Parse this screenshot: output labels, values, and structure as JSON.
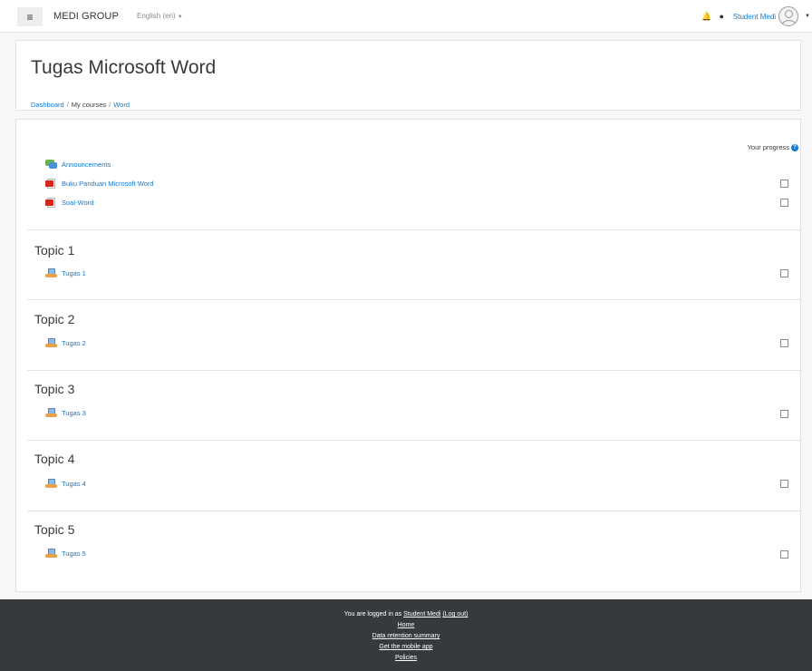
{
  "navbar": {
    "brand": "MEDI GROUP",
    "language": "English (en)",
    "user_name": "Student Medi"
  },
  "header": {
    "title": "Tugas Microsoft Word",
    "breadcrumb": [
      "Dashboard",
      "My courses",
      "Word"
    ]
  },
  "course": {
    "progress_label": "Your progress",
    "general_activities": [
      {
        "label": "Announcements",
        "icon": "forum-icon",
        "has_checkbox": false
      },
      {
        "label": "Buku Panduan Microsoft Word",
        "icon": "pdf-icon",
        "has_checkbox": true
      },
      {
        "label": "Soal-Word",
        "icon": "pdf-icon",
        "has_checkbox": true
      }
    ],
    "topics": [
      {
        "title": "Topic 1",
        "activity": "Tugas 1",
        "icon": "assignment-icon"
      },
      {
        "title": "Topic 2",
        "activity": "Tugas 2",
        "icon": "assignment-icon"
      },
      {
        "title": "Topic 3",
        "activity": "Tugas 3",
        "icon": "assignment-icon"
      },
      {
        "title": "Topic 4",
        "activity": "Tugas 4",
        "icon": "assignment-icon"
      },
      {
        "title": "Topic 5",
        "activity": "Tugas 5",
        "icon": "assignment-icon"
      }
    ]
  },
  "footer": {
    "logged_in_prefix": "You are logged in as",
    "user_link": "Student Medi",
    "logout_link": "(Log out)",
    "home_link": "Home",
    "data_retention_link": "Data retention summary",
    "mobile_app_link": "Get the mobile app",
    "policies_link": "Policies"
  },
  "colors": {
    "link": "#1177d1",
    "footer_bg": "#373a3c"
  }
}
